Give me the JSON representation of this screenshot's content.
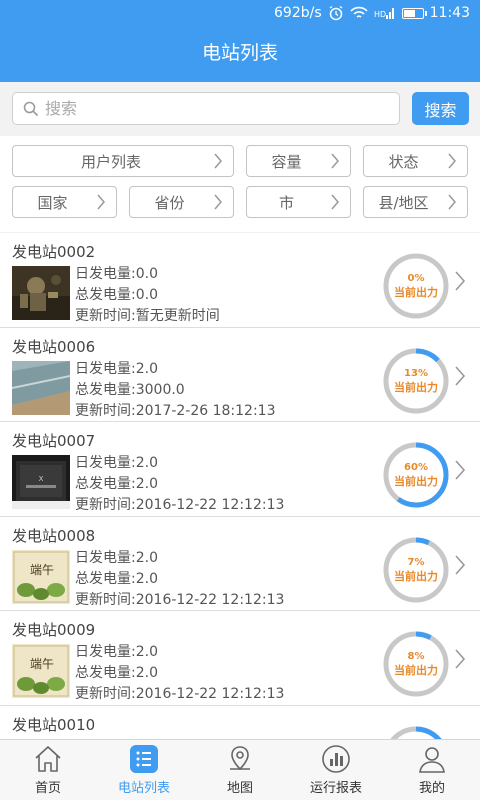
{
  "status_bar": {
    "speed": "692b/s",
    "time": "11:43"
  },
  "header": {
    "title": "电站列表"
  },
  "search": {
    "placeholder": "搜索",
    "button_label": "搜索"
  },
  "filters": {
    "user_list": "用户列表",
    "capacity": "容量",
    "status": "状态",
    "country": "国家",
    "province": "省份",
    "city": "市",
    "county": "县/地区"
  },
  "gauge_label": "当前出力",
  "colors": {
    "primary": "#3f9cf0",
    "gauge_text": "#e8892a",
    "gauge_track": "#c8c8c8"
  },
  "stations": [
    {
      "name": "发电站0002",
      "daily": "日发电量:0.0",
      "total": "总发电量:0.0",
      "updated": "更新时间:暂无更新时间",
      "percent": 0,
      "percent_label": "0%",
      "thumb": "robot-photo"
    },
    {
      "name": "发电站0006",
      "daily": "日发电量:2.0",
      "total": "总发电量:3000.0",
      "updated": "更新时间:2017-2-26 18:12:13",
      "percent": 13,
      "percent_label": "13%",
      "thumb": "panel-photo"
    },
    {
      "name": "发电站0007",
      "daily": "日发电量:2.0",
      "total": "总发电量:2.0",
      "updated": "更新时间:2016-12-22 12:12:13",
      "percent": 60,
      "percent_label": "60%",
      "thumb": "screen-photo"
    },
    {
      "name": "发电站0008",
      "daily": "日发电量:2.0",
      "total": "总发电量:2.0",
      "updated": "更新时间:2016-12-22 12:12:13",
      "percent": 7,
      "percent_label": "7%",
      "thumb": "duanwu-picture"
    },
    {
      "name": "发电站0009",
      "daily": "日发电量:2.0",
      "total": "总发电量:2.0",
      "updated": "更新时间:2016-12-22 12:12:13",
      "percent": 8,
      "percent_label": "8%",
      "thumb": "duanwu-picture"
    },
    {
      "name": "发电站0010",
      "daily": "",
      "total": "",
      "updated": "",
      "percent": 20,
      "percent_label": "",
      "thumb": ""
    }
  ],
  "thumb_text": {
    "duanwu": "端午"
  },
  "nav": [
    {
      "label": "首页",
      "icon": "home-icon"
    },
    {
      "label": "电站列表",
      "icon": "list-icon"
    },
    {
      "label": "地图",
      "icon": "map-pin-icon"
    },
    {
      "label": "运行报表",
      "icon": "chart-icon"
    },
    {
      "label": "我的",
      "icon": "user-icon"
    }
  ]
}
